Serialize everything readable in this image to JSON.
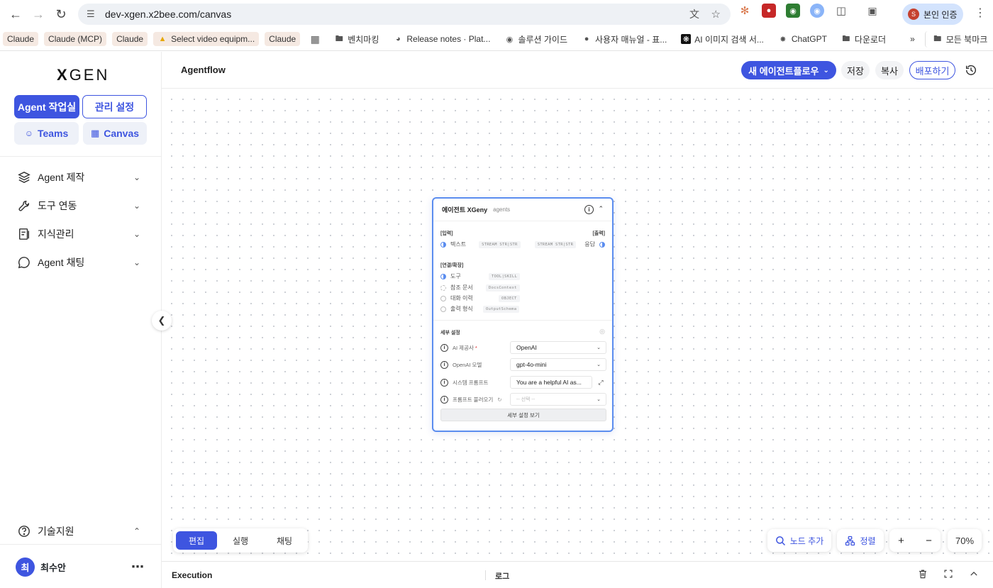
{
  "browser": {
    "url": "dev-xgen.x2bee.com/canvas",
    "profile_label": "본인 인증",
    "profile_initial": "S",
    "bookmarks": [
      {
        "label": "Claude",
        "chip": true
      },
      {
        "label": "Claude (MCP)",
        "chip": true
      },
      {
        "label": "Claude",
        "chip": true
      },
      {
        "label": "Select video equipm...",
        "chip": true
      },
      {
        "label": "Claude",
        "chip": true
      },
      {
        "label": "벤치마킹",
        "chip": false
      },
      {
        "label": "Release notes · Plat...",
        "chip": false
      },
      {
        "label": "솔루션 가이드",
        "chip": false
      },
      {
        "label": "사용자 매뉴얼 - 표...",
        "chip": false
      },
      {
        "label": "AI 이미지 검색 서...",
        "chip": false
      },
      {
        "label": "ChatGPT",
        "chip": false
      },
      {
        "label": "다운로더",
        "chip": false
      }
    ],
    "all_bookmarks": "모든 북마크"
  },
  "sidebar": {
    "logo_prefix": "X",
    "logo_suffix": "GEN",
    "tab_studio": "Agent 작업실",
    "tab_admin": "관리 설정",
    "tab_teams": "Teams",
    "tab_canvas": "Canvas",
    "menu": [
      {
        "label": "Agent 제작"
      },
      {
        "label": "도구 연동"
      },
      {
        "label": "지식관리"
      },
      {
        "label": "Agent 채팅"
      }
    ],
    "support": "기술지원",
    "user_name": "최수안",
    "user_initial": "최"
  },
  "header": {
    "title": "Agentflow",
    "new_flow": "새 에이전트플로우",
    "save": "저장",
    "copy": "복사",
    "deploy": "배포하기"
  },
  "node": {
    "title": "에이전트 XGeny",
    "subtitle": "agents",
    "input_label": "[입력]",
    "output_label": "[출력]",
    "input_port": "텍스트",
    "input_type": "STREAM STR|STR",
    "output_type": "STREAM STR|STR",
    "output_port": "응답",
    "ext_label": "[연결/확장]",
    "ext_ports": [
      {
        "name": "도구",
        "type": "TOOL|SKILL"
      },
      {
        "name": "참조 문서",
        "type": "DocsContext"
      },
      {
        "name": "대화 이력",
        "type": "OBJECT"
      },
      {
        "name": "출력 형식",
        "type": "OutputSchema"
      }
    ],
    "settings_label": "세부 설정",
    "fields": [
      {
        "label": "AI 제공사",
        "required": "*",
        "value": "OpenAI"
      },
      {
        "label": "OpenAI 모델",
        "value": "gpt-4o-mini"
      },
      {
        "label": "시스템 프롬프트",
        "value": "You are a helpful AI as..."
      },
      {
        "label": "프롬프트 불러오기",
        "value": "-- 선택 --"
      }
    ],
    "detail_button": "세부 설정 보기"
  },
  "canvas": {
    "modes": [
      "편집",
      "실행",
      "채팅"
    ],
    "active_mode": "편집",
    "add_node": "노드 추가",
    "arrange": "정렬",
    "zoom_in": "+",
    "zoom_out": "−",
    "zoom_level": "70%"
  },
  "execution": {
    "title": "Execution",
    "log": "로그"
  },
  "colors": {
    "accent": "#3e55e0",
    "node_border": "#5b8def"
  }
}
